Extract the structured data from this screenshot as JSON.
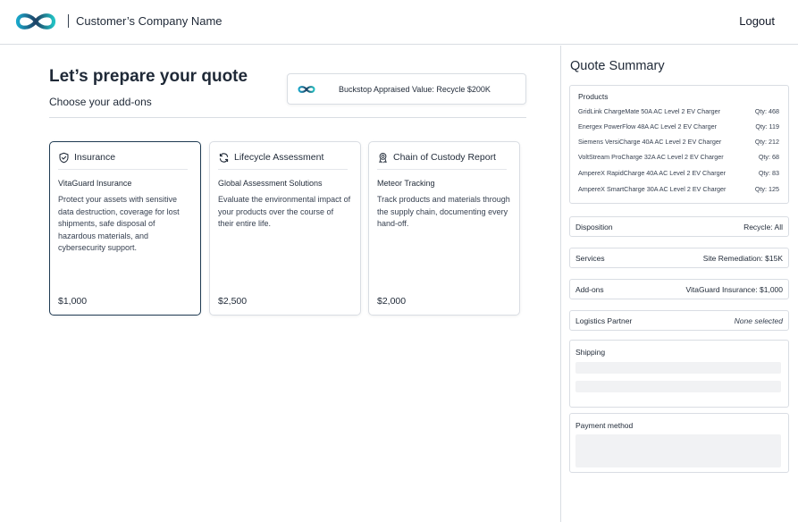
{
  "header": {
    "logo_icon": "infinity-logo-icon",
    "company_name": "Customer’s Company Name",
    "logout_label": "Logout"
  },
  "main": {
    "title": "Let’s prepare your quote",
    "subtitle": "Choose your add-ons",
    "appraisal": {
      "icon": "infinity-logo-icon",
      "text": "Buckstop Appraised Value: Recycle $200K"
    },
    "cards": [
      {
        "icon": "shield-check-icon",
        "title": "Insurance",
        "product": "VitaGuard Insurance",
        "description": "Protect your assets with sensitive data destruction, coverage for lost shipments, safe disposal of hazardous materials, and cybersecurity support.",
        "price": "$1,000",
        "selected": true
      },
      {
        "icon": "refresh-icon",
        "title": "Lifecycle Assessment",
        "product": "Global Assessment Solutions",
        "description": "Evaluate the environmental impact of your products over the course of their entire life.",
        "price": "$2,500",
        "selected": false
      },
      {
        "icon": "badge-icon",
        "title": "Chain of Custody Report",
        "product": "Meteor Tracking",
        "description": "Track products and materials through the supply chain, documenting every hand-off.",
        "price": "$2,000",
        "selected": false
      }
    ]
  },
  "summary": {
    "title": "Quote Summary",
    "products_label": "Products",
    "products": [
      {
        "name": "GridLink ChargeMate 50A AC Level 2 EV Charger",
        "qty": "Qty: 468"
      },
      {
        "name": "Energex PowerFlow 48A AC Level 2 EV Charger",
        "qty": "Qty: 119"
      },
      {
        "name": "Siemens VersiCharge 40A AC Level 2 EV Charger",
        "qty": "Qty: 212"
      },
      {
        "name": "VoltStream ProCharge 32A AC Level 2 EV Charger",
        "qty": "Qty: 68"
      },
      {
        "name": "AmpereX RapidCharge 40A AC Level 2 EV Charger",
        "qty": "Qty: 83"
      },
      {
        "name": "AmpereX SmartCharge 30A AC Level 2 EV Charger",
        "qty": "Qty: 125"
      }
    ],
    "rows": [
      {
        "label": "Disposition",
        "value": "Recycle: All"
      },
      {
        "label": "Services",
        "value": "Site Remediation: $15K"
      },
      {
        "label": "Add-ons",
        "value": "VitaGuard Insurance: $1,000"
      },
      {
        "label": "Logistics Partner",
        "value": "None selected"
      }
    ],
    "shipping_label": "Shipping",
    "payment_label": "Payment method"
  }
}
